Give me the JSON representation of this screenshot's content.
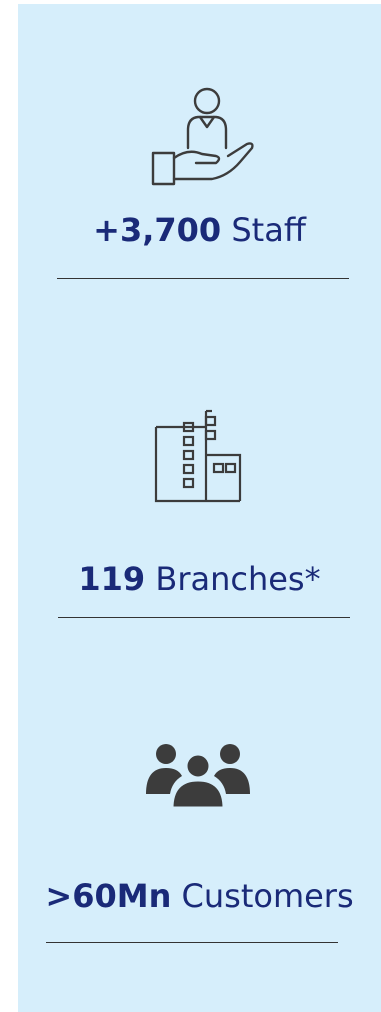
{
  "background_color": "#d6eefb",
  "text_color": "#1a2a78",
  "icon_color": "#3c3c3c",
  "stats": [
    {
      "icon": "hand-holding-person-icon",
      "number": "+3,700",
      "label": "Staff"
    },
    {
      "icon": "office-building-icon",
      "number": "119",
      "label": "Branches*"
    },
    {
      "icon": "group-of-people-icon",
      "number": ">60Mn",
      "label": "Customers"
    }
  ]
}
